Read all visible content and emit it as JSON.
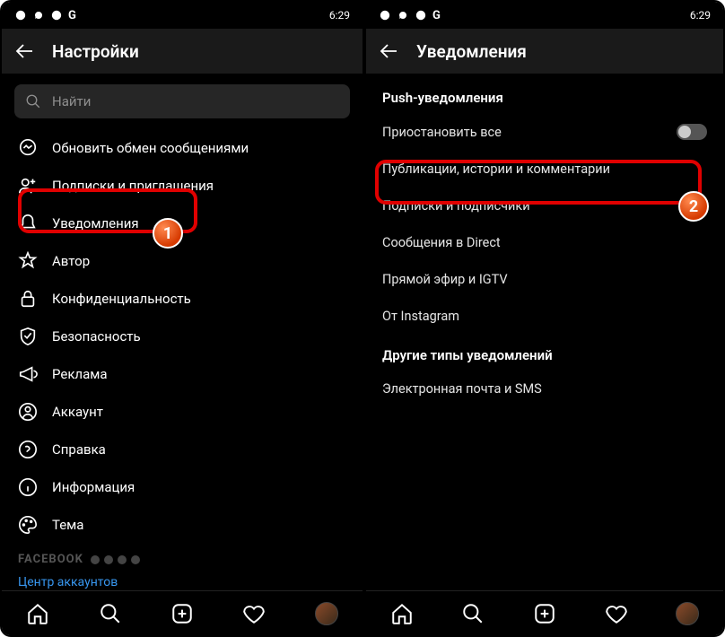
{
  "statusbar": {
    "time": "6:29"
  },
  "left": {
    "header": "Настройки",
    "search_placeholder": "Найти",
    "items": [
      "Обновить обмен сообщениями",
      "Подписки и приглашения",
      "Уведомления",
      "Автор",
      "Конфиденциальность",
      "Безопасность",
      "Реклама",
      "Аккаунт",
      "Справка",
      "Информация",
      "Тема"
    ],
    "facebook_label": "FACEBOOK",
    "accounts_center": "Центр аккаунтов"
  },
  "right": {
    "header": "Уведомления",
    "push_section": "Push-уведомления",
    "push_items": [
      "Приостановить все",
      "Публикации, истории и комментарии",
      "Подписки и подписчики",
      "Сообщения в Direct",
      "Прямой эфир и IGTV",
      "От Instagram"
    ],
    "other_section": "Другие типы уведомлений",
    "other_items": [
      "Электронная почта и SMS"
    ]
  },
  "badges": {
    "one": "1",
    "two": "2"
  }
}
